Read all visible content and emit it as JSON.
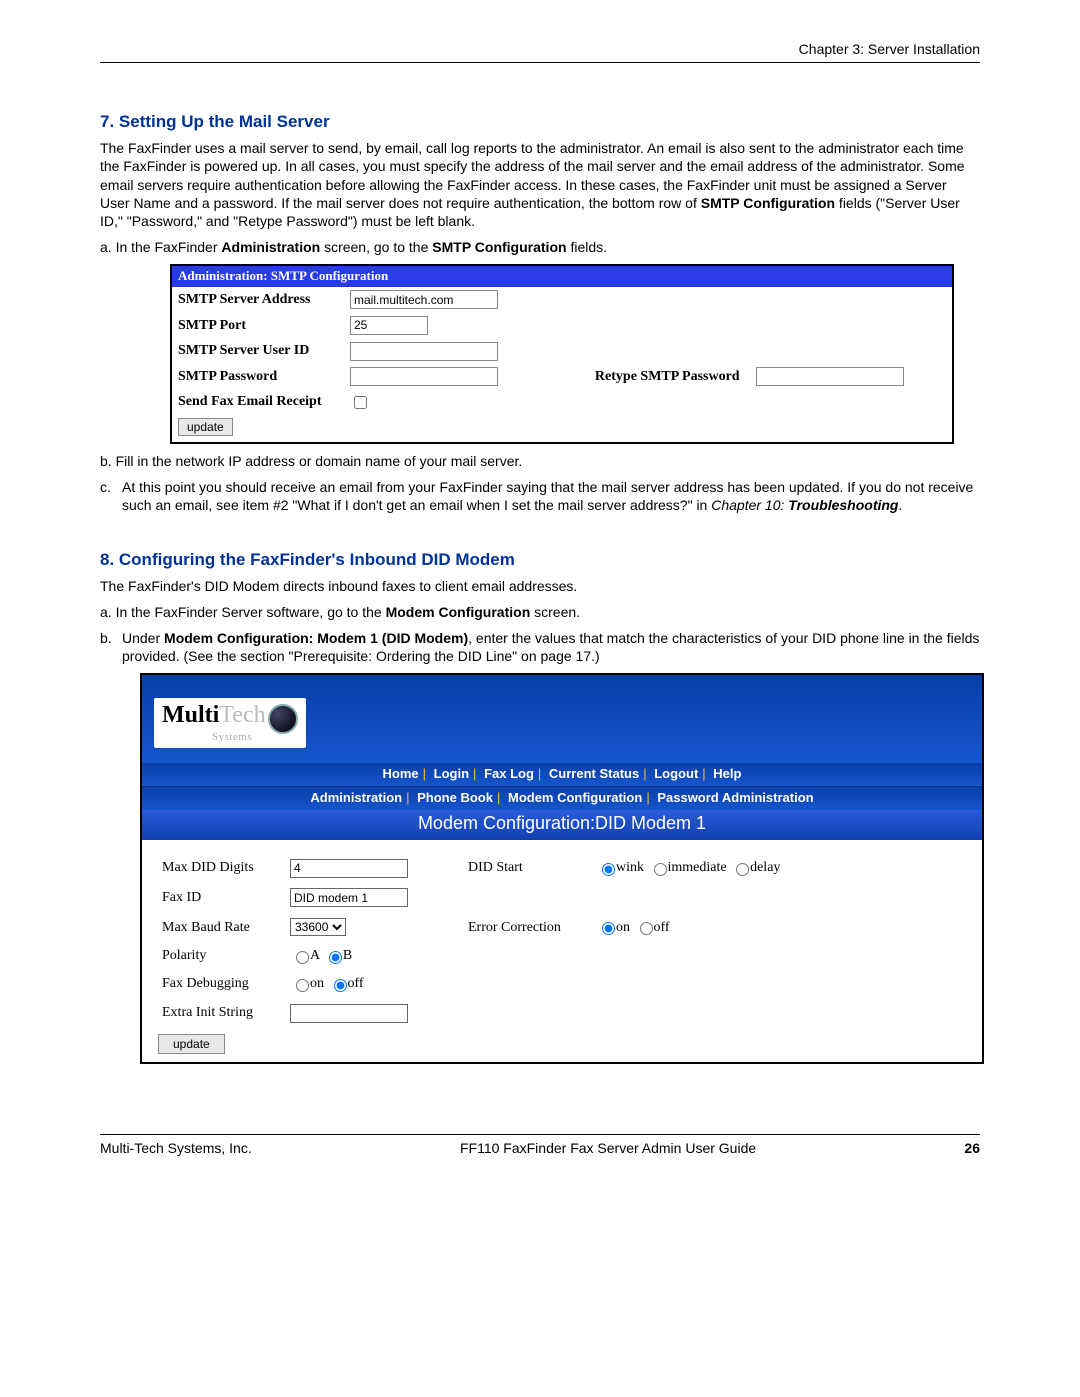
{
  "header": {
    "chapter": "Chapter 3:  Server Installation"
  },
  "section7": {
    "title": "7. Setting Up the Mail Server",
    "intro_pre_bold": "The FaxFinder uses a mail server to send, by email, call log reports to the administrator. An email is also sent to the administrator each time the FaxFinder is powered up. In all cases, you must specify the address of the mail server and the email address of the administrator. Some email servers require authentication before allowing the FaxFinder access.  In these cases, the FaxFinder unit must be assigned a Server User Name and a password.  If the mail server does not require authentication, the bottom row of ",
    "intro_bold": "SMTP Configuration",
    "intro_post_bold": " fields (\"Server User ID,\" \"Password,\" and \"Retype Password\") must be left blank.",
    "step_a_pre": "a. In the FaxFinder ",
    "step_a_b1": "Administration",
    "step_a_mid": " screen, go to the ",
    "step_a_b2": "SMTP Configuration",
    "step_a_post": " fields.",
    "smtp_header": "Administration: SMTP Configuration",
    "smtp": {
      "row1_label": "SMTP Server Address",
      "row1_value": "mail.multitech.com",
      "row2_label": "SMTP Port",
      "row2_value": "25",
      "row3_label": "SMTP Server User ID",
      "row4_label": "SMTP Password",
      "row4_retype_label": "Retype SMTP Password",
      "row5_label": "Send Fax Email Receipt",
      "update": "update"
    },
    "step_b": "b. Fill in the network IP address or domain name of your mail server.",
    "step_c_main": "c. At this point you should receive an email from your FaxFinder saying that the mail server address has been updated.  If you do not receive such an email, see item #2 \"What if I don't get an email when I set the mail server address?\" in ",
    "step_c_italic": "Chapter 10: ",
    "step_c_italic_bold": "Troubleshooting",
    "step_c_period": "."
  },
  "section8": {
    "title": "8. Configuring the FaxFinder's Inbound DID Modem",
    "intro": "The FaxFinder's DID Modem directs inbound faxes to client email addresses.",
    "step_a_pre": "a. In the FaxFinder Server software, go to the ",
    "step_a_bold": "Modem Configuration",
    "step_a_post": " screen.",
    "step_b_pre": "b. Under ",
    "step_b_bold": "Modem Configuration: Modem 1 (DID Modem)",
    "step_b_post": ", enter the values that match the characteristics of your DID phone line in the fields provided.  (See the section \"Prerequisite: Ordering the DID Line\" on page 17.)",
    "logo": {
      "multi": "Multi",
      "tech": "Tech",
      "systems": "Systems"
    },
    "nav1": {
      "home": "Home",
      "login": "Login",
      "faxlog": "Fax Log",
      "current": "Current Status",
      "logout": "Logout",
      "help": "Help"
    },
    "nav2": {
      "admin": "Administration",
      "phone": "Phone Book",
      "modem": "Modem Configuration",
      "pwadmin": "Password Administration"
    },
    "modem_title": "Modem Configuration:DID Modem 1",
    "form": {
      "max_did_label": "Max DID Digits",
      "max_did_value": "4",
      "did_start_label": "DID Start",
      "did_start_opts": {
        "wink": "wink",
        "immediate": "immediate",
        "delay": "delay"
      },
      "faxid_label": "Fax ID",
      "faxid_value": "DID modem 1",
      "baud_label": "Max Baud Rate",
      "baud_value": "33600",
      "err_label": "Error Correction",
      "on": "on",
      "off": "off",
      "polarity_label": "Polarity",
      "A": "A",
      "B": "B",
      "debug_label": "Fax Debugging",
      "extra_label": "Extra Init String",
      "update": "update"
    }
  },
  "footer": {
    "left": "Multi-Tech Systems, Inc.",
    "center": "FF110 FaxFinder Fax Server Admin User Guide",
    "right": "26"
  }
}
